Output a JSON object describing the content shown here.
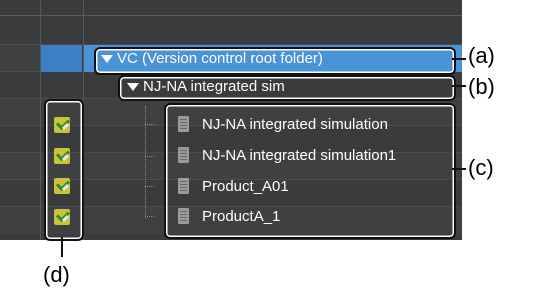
{
  "tree": {
    "root_label": "VC (Version control root folder)",
    "child_label": "NJ-NA integrated sim",
    "items": [
      {
        "label": "NJ-NA integrated simulation"
      },
      {
        "label": "NJ-NA integrated simulation1"
      },
      {
        "label": "Product_A01"
      },
      {
        "label": "ProductA_1"
      }
    ]
  },
  "status_icons": [
    "checked-out-icon",
    "checked-out-icon",
    "checked-out-icon",
    "checked-out-icon"
  ],
  "callouts": {
    "a": "(a)",
    "b": "(b)",
    "c": "(c)",
    "d": "(d)"
  },
  "colors": {
    "panel_bg": "#3a3b3c",
    "selection": "#4a93d6",
    "selection_cell": "#3d7fc4",
    "text": "#ffffff"
  }
}
